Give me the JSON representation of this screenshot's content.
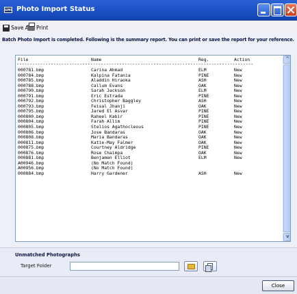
{
  "window": {
    "app_icon_text": "SIMS",
    "title": "Photo Import Status"
  },
  "toolbar": {
    "save_label": "Save As",
    "print_label": "Print"
  },
  "message": "Batch Photo Import is completed. Following is the summary report. You can print or save the report for your reference.",
  "report": {
    "columns": [
      "File",
      "Name",
      "Reg.",
      "Action"
    ],
    "rule": "------------------------------------------------------------------------------------------",
    "rows": [
      {
        "file": "000781.bmp",
        "name": "Carina Ahmad",
        "reg": "ELM",
        "action": "New"
      },
      {
        "file": "000784.bmp",
        "name": "Kalpina Fatania",
        "reg": "PINE",
        "action": "New"
      },
      {
        "file": "000785.bmp",
        "name": "Aladdin Hiraoka",
        "reg": "ASH",
        "action": "New"
      },
      {
        "file": "000788.bmp",
        "name": "Callum Evans",
        "reg": "OAK",
        "action": "New"
      },
      {
        "file": "000790.bmp",
        "name": "Sarah Jackson",
        "reg": "ELM",
        "action": "New"
      },
      {
        "file": "000791.bmp",
        "name": "Eric Estrada",
        "reg": "PINE",
        "action": "New"
      },
      {
        "file": "000792.bmp",
        "name": "Christopher Baggley",
        "reg": "ASH",
        "action": "New"
      },
      {
        "file": "000793.bmp",
        "name": "Feisal Jhanji",
        "reg": "OAK",
        "action": "New"
      },
      {
        "file": "000795.bmp",
        "name": "Jared El Asvar",
        "reg": "PINE",
        "action": "New"
      },
      {
        "file": "000800.bmp",
        "name": "Raheel Kabir",
        "reg": "PINE",
        "action": "New"
      },
      {
        "file": "000804.bmp",
        "name": "Farah Allim",
        "reg": "PINE",
        "action": "New"
      },
      {
        "file": "000805.bmp",
        "name": "Stelios Agathocleous",
        "reg": "PINE",
        "action": "New"
      },
      {
        "file": "000806.bmp",
        "name": "Jose Bandaras",
        "reg": "OAK",
        "action": "New"
      },
      {
        "file": "000808.bmp",
        "name": "Maria Bandaras",
        "reg": "OAK",
        "action": "New"
      },
      {
        "file": "000811.bmp",
        "name": "Katie-May Falmer",
        "reg": "OAK",
        "action": "New"
      },
      {
        "file": "000875.bmp",
        "name": "Courtney Aldridge",
        "reg": "PINE",
        "action": "New"
      },
      {
        "file": "000876.bmp",
        "name": "Rose Chaimpa",
        "reg": "OAK",
        "action": "New"
      },
      {
        "file": "000881.bmp",
        "name": "Benjamen Elliot",
        "reg": "ELM",
        "action": "New"
      },
      {
        "file": "A00946.bmp",
        "name": "(No Match Found)",
        "reg": "",
        "action": ""
      },
      {
        "file": "A00956.bmp",
        "name": "(No Match Found)",
        "reg": "",
        "action": ""
      },
      {
        "file": "000884.bmp",
        "name": "Harry Gardener",
        "reg": "ASH",
        "action": "New"
      }
    ]
  },
  "unmatched": {
    "title": "Unmatched Photographs",
    "target_label": "Target Folder",
    "target_value": ""
  },
  "footer": {
    "close_label": "Close"
  }
}
